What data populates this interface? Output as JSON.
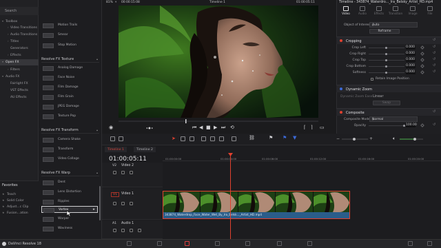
{
  "effects_tree": {
    "search_label": "Search",
    "items": [
      {
        "label": "Toolbox"
      },
      {
        "label": "Video Transitions"
      },
      {
        "label": "Audio Transitions"
      },
      {
        "label": "Titles"
      },
      {
        "label": "Generators"
      },
      {
        "label": "Effects"
      },
      {
        "label": "Open FX"
      },
      {
        "label": "Filters"
      },
      {
        "label": "Audio FX"
      },
      {
        "label": "Fairlight FX"
      },
      {
        "label": "VST Effects"
      },
      {
        "label": "AU Effects"
      }
    ]
  },
  "favorites": {
    "header": "Favorites",
    "items": [
      {
        "label": "Teach"
      },
      {
        "label": "Solid Color"
      },
      {
        "label": "Adjust...c Clip"
      },
      {
        "label": "Fusion...ation"
      }
    ]
  },
  "effects_list": {
    "top_items": [
      {
        "label": "Motion Trails"
      },
      {
        "label": "Smear"
      },
      {
        "label": "Stop Motion"
      }
    ],
    "sections": [
      {
        "title": "Resolve FX Texture",
        "items": [
          {
            "label": "Analog Damage"
          },
          {
            "label": "Face Noise"
          },
          {
            "label": "Film Damage"
          },
          {
            "label": "Film Grain"
          },
          {
            "label": "JPEG Damage"
          },
          {
            "label": "Texture Pop"
          }
        ]
      },
      {
        "title": "Resolve FX Transform",
        "items": [
          {
            "label": "Camera Shake"
          },
          {
            "label": "Transform"
          },
          {
            "label": "Video Collage"
          }
        ]
      },
      {
        "title": "Resolve FX Warp",
        "items": [
          {
            "label": "Dent"
          },
          {
            "label": "Lens Distortion"
          },
          {
            "label": "Ripples"
          },
          {
            "label": "Vortex"
          },
          {
            "label": "Warper"
          },
          {
            "label": "Waviness"
          }
        ]
      }
    ]
  },
  "viewer": {
    "zoom": "81%",
    "source_timecode": "00:00:15:08",
    "timeline_name": "Timeline 1",
    "record_timecode": "01:00:05:11"
  },
  "inspector": {
    "title": "Timeline - 343874_Waterdro..._Ira_Belsky_Artist_HD.mp4",
    "tabs": [
      {
        "label": "Video"
      },
      {
        "label": "Audio"
      },
      {
        "label": "Effects"
      },
      {
        "label": "Transition"
      },
      {
        "label": "Image"
      },
      {
        "label": "File"
      }
    ],
    "object_of_interest_label": "Object of Interest",
    "object_of_interest_value": "Auto",
    "reframe_label": "Reframe",
    "cropping": {
      "title": "Cropping",
      "rows": [
        {
          "label": "Crop Left",
          "value": "0.000"
        },
        {
          "label": "Crop Right",
          "value": "0.000"
        },
        {
          "label": "Crop Top",
          "value": "0.000"
        },
        {
          "label": "Crop Bottom",
          "value": "0.000"
        },
        {
          "label": "Softness",
          "value": "0.000"
        }
      ],
      "retain_label": "Retain Image Position"
    },
    "dynamic_zoom": {
      "title": "Dynamic Zoom",
      "ease_label": "Dynamic Zoom Ease",
      "ease_value": "Linear",
      "swap_label": "Swap"
    },
    "composite": {
      "title": "Composite",
      "mode_label": "Composite Mode",
      "mode_value": "Normal",
      "opacity_label": "Opacity",
      "opacity_value": "100.00"
    },
    "colors": {
      "red": "#e0412f",
      "blue": "#3c6ad9"
    }
  },
  "timeline": {
    "tabs": [
      {
        "label": "Timeline 1"
      },
      {
        "label": "Timeline 2"
      }
    ],
    "timecode": "01:00:05:11",
    "ruler": [
      "01:00:00:00",
      "01:00:04:00",
      "01:00:08:00",
      "01:00:12:00",
      "01:00:16:00",
      "01:00:20:00"
    ],
    "tracks": [
      {
        "id": "V2",
        "name": "Video 2"
      },
      {
        "id": "V1",
        "name": "Video 1"
      },
      {
        "id": "A1",
        "name": "Audio 1"
      }
    ],
    "clip_name": "343874_Waterdrop_Face_Water_Wet_By_Ira_Belsk..._Artist_HD.mp4"
  },
  "status_bar": {
    "app_name": "DaVinci Resolve 18"
  }
}
